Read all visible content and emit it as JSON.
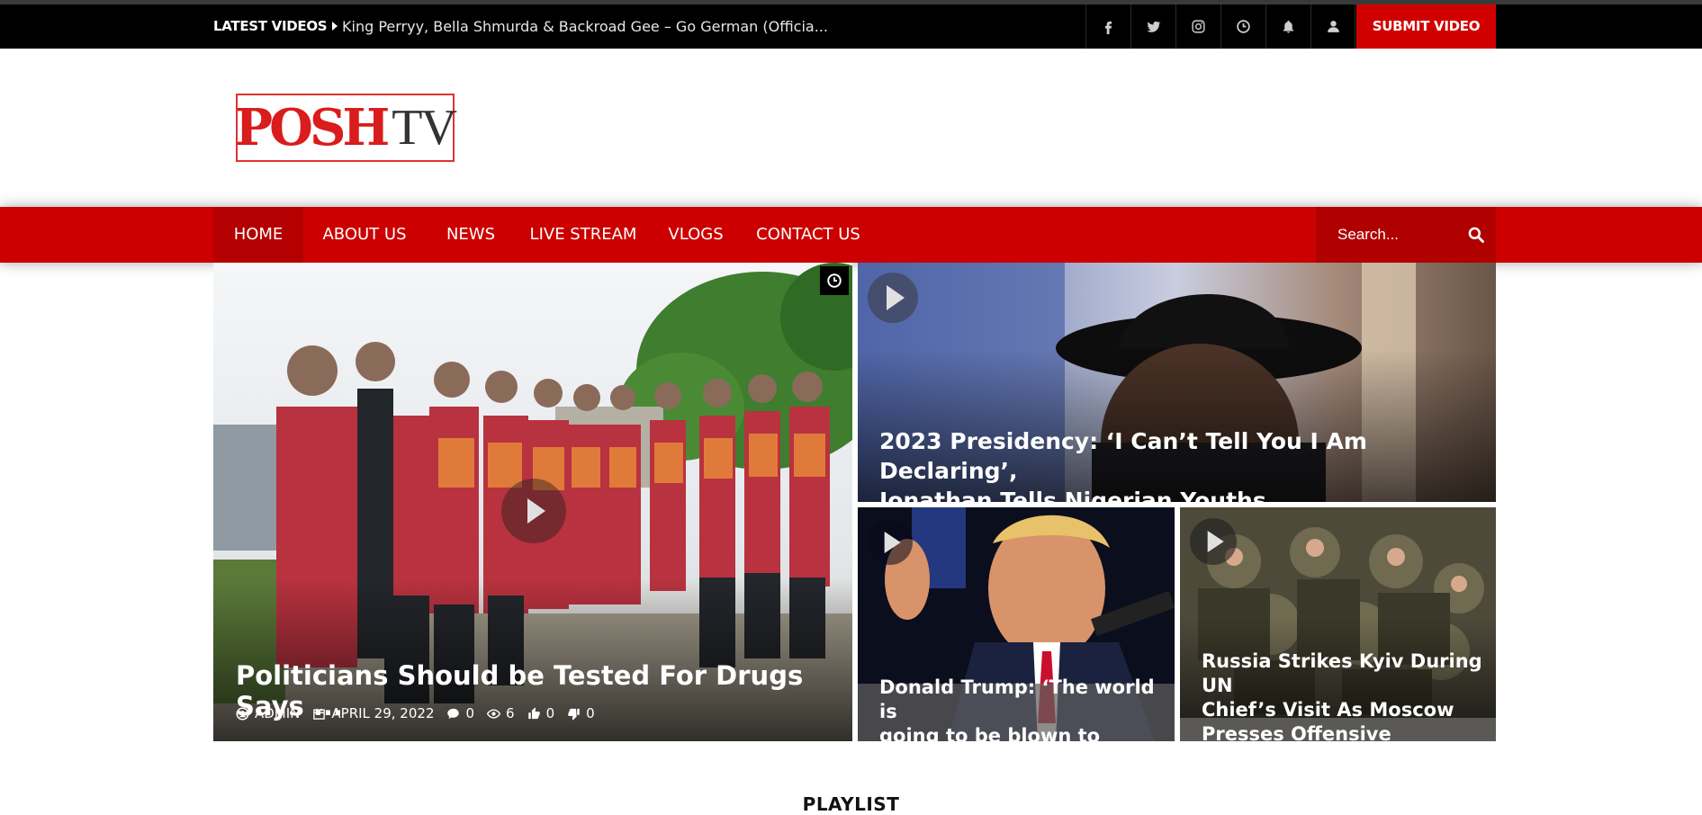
{
  "topbar": {
    "latest_label": "LATEST VIDEOS",
    "latest_title": "King Perryy, Bella Shmurda & Backroad Gee – Go German (Officia...",
    "social_icons": [
      "facebook-icon",
      "twitter-icon",
      "instagram-icon",
      "clock-icon",
      "bell-icon",
      "user-icon"
    ],
    "submit_label": "SUBMIT VIDEO"
  },
  "logo": {
    "posh": "POSH",
    "tv": "TV"
  },
  "nav": {
    "items": [
      "HOME",
      "ABOUT US",
      "NEWS",
      "LIVE STREAM",
      "VLOGS",
      "CONTACT US"
    ],
    "active": "HOME",
    "search_placeholder": "Search..."
  },
  "featured": {
    "main": {
      "title": "Politicians Should be Tested For Drugs Says ...",
      "author": "ADMIN",
      "date": "APRIL 29, 2022",
      "comments": "0",
      "views": "6",
      "likes": "0",
      "dislikes": "0"
    },
    "top_right": {
      "title_line1": "2023 Presidency: ‘I Can’t Tell You I Am Declaring’,",
      "title_line2": "Jonathan Tells Nigerian Youths"
    },
    "bottom_left": {
      "title_line1": "Donald Trump: ‘The world is",
      "title_line2": "going to be blown to pieces’"
    },
    "bottom_right": {
      "title_line1": "Russia Strikes Kyiv During UN",
      "title_line2": "Chief’s Visit As Moscow",
      "title_line3": "Presses Offensive"
    }
  },
  "colors": {
    "brand_red": "#cc0000",
    "topbar_bg": "#000000"
  },
  "playlist_heading": "PLAYLIST"
}
